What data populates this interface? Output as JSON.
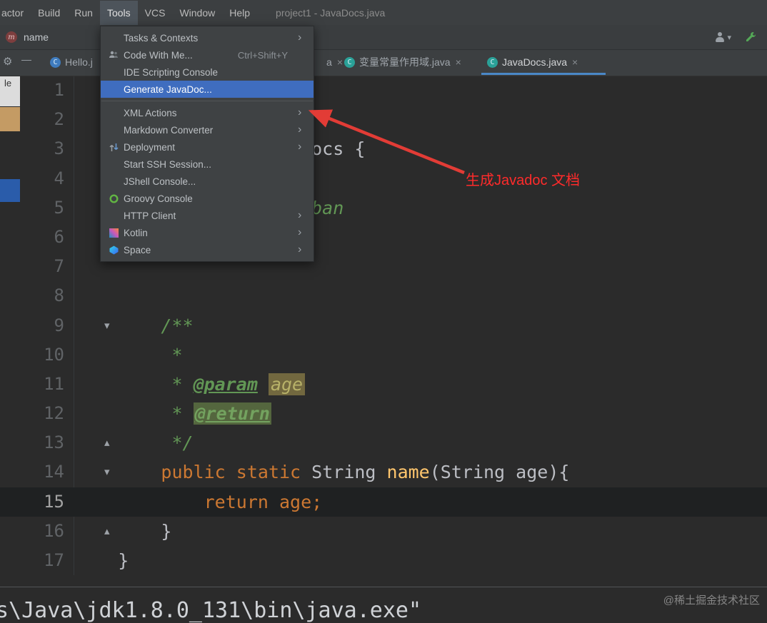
{
  "window": {
    "title": "project1 - JavaDocs.java"
  },
  "menubar": {
    "items": [
      {
        "label": "actor"
      },
      {
        "label": "Build"
      },
      {
        "label": "Run"
      },
      {
        "label": "Tools"
      },
      {
        "label": "VCS"
      },
      {
        "label": "Window"
      },
      {
        "label": "Help"
      }
    ]
  },
  "navbar": {
    "symbol": "name",
    "method_icon": "m"
  },
  "tabbar": {
    "tabs": [
      {
        "label": "Hello.j",
        "close": ""
      },
      {
        "label": "a",
        "close": "×"
      },
      {
        "label": "变量常量作用域.java",
        "close": "×"
      },
      {
        "label": "JavaDocs.java",
        "close": "×"
      }
    ]
  },
  "tools_menu": {
    "items": [
      {
        "label": "Tasks & Contexts",
        "submenu": true
      },
      {
        "label": "Code With Me...",
        "icon": "code-with-me",
        "shortcut": "Ctrl+Shift+Y"
      },
      {
        "label": "IDE Scripting Console"
      },
      {
        "label": "Generate JavaDoc...",
        "selected": true
      },
      {
        "separator": true
      },
      {
        "label": "XML Actions",
        "submenu": true
      },
      {
        "label": "Markdown Converter",
        "submenu": true
      },
      {
        "label": "Deployment",
        "icon": "deployment",
        "submenu": true
      },
      {
        "label": "Start SSH Session..."
      },
      {
        "label": "JShell Console..."
      },
      {
        "label": "Groovy Console",
        "icon": "groovy"
      },
      {
        "label": "HTTP Client",
        "submenu": true
      },
      {
        "label": "Kotlin",
        "icon": "kotlin",
        "submenu": true
      },
      {
        "label": "Space",
        "icon": "space",
        "submenu": true
      }
    ]
  },
  "annotation": {
    "text": "生成Javadoc 文档",
    "color": "#ff2b2b"
  },
  "left_strip": {
    "label": "le"
  },
  "editor": {
    "lines": [
      {
        "num": "1",
        "tokens": []
      },
      {
        "num": "2",
        "tokens": []
      },
      {
        "num": "3",
        "tokens": [
          {
            "t": "                      ocs {",
            "c": "plain"
          }
        ]
      },
      {
        "num": "4",
        "tokens": []
      },
      {
        "num": "5",
        "tokens": [
          {
            "t": "                      ban",
            "c": "comment"
          }
        ]
      },
      {
        "num": "6",
        "tokens": []
      },
      {
        "num": "7",
        "tokens": []
      },
      {
        "num": "8",
        "tokens": []
      },
      {
        "num": "9",
        "fold": "down",
        "tokens": [
          {
            "t": "        /**",
            "c": "comment"
          }
        ]
      },
      {
        "num": "10",
        "tokens": [
          {
            "t": "         *",
            "c": "comment"
          }
        ]
      },
      {
        "num": "11",
        "tokens": [
          {
            "t": "         * ",
            "c": "comment"
          },
          {
            "t": "@param",
            "c": "doctag"
          },
          {
            "t": " ",
            "c": "plain"
          },
          {
            "t": "age",
            "c": "param-hl"
          }
        ]
      },
      {
        "num": "12",
        "tokens": [
          {
            "t": "         * ",
            "c": "comment"
          },
          {
            "t": "@return",
            "c": "doctag-hl"
          }
        ]
      },
      {
        "num": "13",
        "fold": "up",
        "tokens": [
          {
            "t": "         */",
            "c": "comment"
          }
        ]
      },
      {
        "num": "14",
        "fold": "down",
        "tokens": [
          {
            "t": "        ",
            "c": "plain"
          },
          {
            "t": "public",
            "c": "keyword"
          },
          {
            "t": " ",
            "c": "plain"
          },
          {
            "t": "static",
            "c": "keyword"
          },
          {
            "t": " String ",
            "c": "plain"
          },
          {
            "t": "name",
            "c": "method"
          },
          {
            "t": "(String age){",
            "c": "plain"
          }
        ]
      },
      {
        "num": "15",
        "current": true,
        "tokens": [
          {
            "t": "            ",
            "c": "plain"
          },
          {
            "t": "return",
            "c": "keyword"
          },
          {
            "t": " ",
            "c": "plain"
          },
          {
            "t": "age;",
            "c": "keyword"
          }
        ]
      },
      {
        "num": "16",
        "fold": "up",
        "tokens": [
          {
            "t": "        }",
            "c": "plain"
          }
        ]
      },
      {
        "num": "17",
        "tokens": [
          {
            "t": "    }",
            "c": "plain"
          }
        ]
      }
    ]
  },
  "bottom": {
    "output": "s\\Java\\jdk1.8.0_131\\bin\\java.exe\"",
    "watermark": "@稀土掘金技术社区"
  }
}
